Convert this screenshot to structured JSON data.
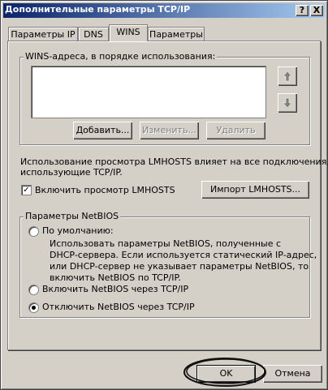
{
  "window": {
    "title": "Дополнительные параметры TCP/IP",
    "help_label": "?",
    "close_label": "X"
  },
  "tabs": [
    {
      "label": "Параметры IP"
    },
    {
      "label": "DNS"
    },
    {
      "label": "WINS"
    },
    {
      "label": "Параметры"
    }
  ],
  "wins": {
    "group_label": "WINS-адреса, в порядке использования:",
    "add_label": "Добавить...",
    "edit_label": "Изменить...",
    "delete_label": "Удалить",
    "up_icon": "arrow-up-icon",
    "down_icon": "arrow-down-icon"
  },
  "lmhosts": {
    "info_line1": "Использование просмотра LMHOSTS влияет на все подключения,",
    "info_line2": "использующие TCP/IP.",
    "enable_label": "Включить просмотр LMHOSTS",
    "enable_checked": true,
    "import_label": "Импорт LMHOSTS..."
  },
  "netbios": {
    "group_label": "Параметры NetBIOS",
    "default_label": "По умолчанию:",
    "default_desc": [
      "Использовать параметры NetBIOS, полученные с",
      "DHCP-сервера. Если используется статический IP-адрес,",
      "или DHCP-сервер не указывает параметры NetBIOS, то",
      "включить NetBIOS по TCP/IP."
    ],
    "enable_label": "Включить NetBIOS через TCP/IP",
    "disable_label": "Отключить NetBIOS через TCP/IP",
    "selected": "disable"
  },
  "footer": {
    "ok_label": "OK",
    "cancel_label": "Отмена"
  }
}
